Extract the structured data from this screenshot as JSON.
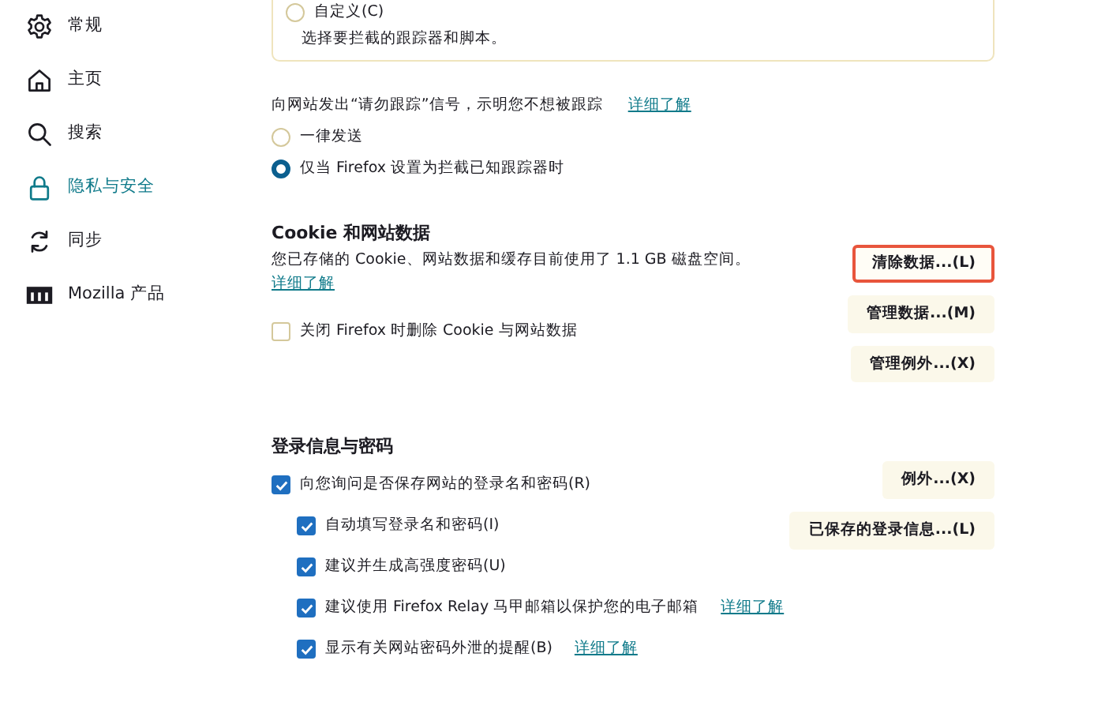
{
  "sidebar": {
    "items": [
      {
        "label": "常规",
        "kind": "gear",
        "selected": false
      },
      {
        "label": "主页",
        "kind": "home",
        "selected": false
      },
      {
        "label": "搜索",
        "kind": "search",
        "selected": false
      },
      {
        "label": "隐私与安全",
        "kind": "lock",
        "selected": true
      },
      {
        "label": "同步",
        "kind": "sync",
        "selected": false
      },
      {
        "label": "Mozilla 产品",
        "kind": "logo",
        "selected": false
      }
    ]
  },
  "tracking_card": {
    "option": {
      "label": "自定义(C)",
      "selected": false
    },
    "description": "选择要拦截的跟踪器和脚本。"
  },
  "do_not_track": {
    "text": "向网站发出“请勿跟踪”信号，示明您不想被跟踪",
    "link": "详细了解",
    "options": [
      {
        "label": "一律发送",
        "selected": false
      },
      {
        "label": "仅当 Firefox 设置为拦截已知跟踪器时",
        "selected": true
      }
    ]
  },
  "cookies": {
    "heading": "Cookie 和网站数据",
    "usage_text": "您已存储的 Cookie、网站数据和缓存目前使用了 1.1 GB 磁盘空间。",
    "link": "详细了解",
    "checkbox": {
      "label": "关闭 Firefox 时删除 Cookie 与网站数据",
      "checked": false
    },
    "buttons": [
      {
        "label": "清除数据...(L)",
        "highlighted": true
      },
      {
        "label": "管理数据...(M)",
        "highlighted": false
      },
      {
        "label": "管理例外...(X)",
        "highlighted": false
      }
    ]
  },
  "logins": {
    "heading": "登录信息与密码",
    "options": [
      {
        "label": "向您询问是否保存网站的登录名和密码(R)",
        "checked": true,
        "children": [
          {
            "label": "自动填写登录名和密码(I)",
            "checked": true
          },
          {
            "label": "建议并生成高强度密码(U)",
            "checked": true
          },
          {
            "label": "建议使用 Firefox Relay 马甲邮箱以保护您的电子邮箱",
            "checked": true,
            "link": "详细了解"
          },
          {
            "label": "显示有关网站密码外泄的提醒(B)",
            "checked": true,
            "link": "详细了解"
          }
        ]
      }
    ],
    "buttons": [
      {
        "label": "例外...(X)",
        "highlighted": false
      },
      {
        "label": "已保存的登录信息...(L)",
        "highlighted": false
      }
    ]
  }
}
